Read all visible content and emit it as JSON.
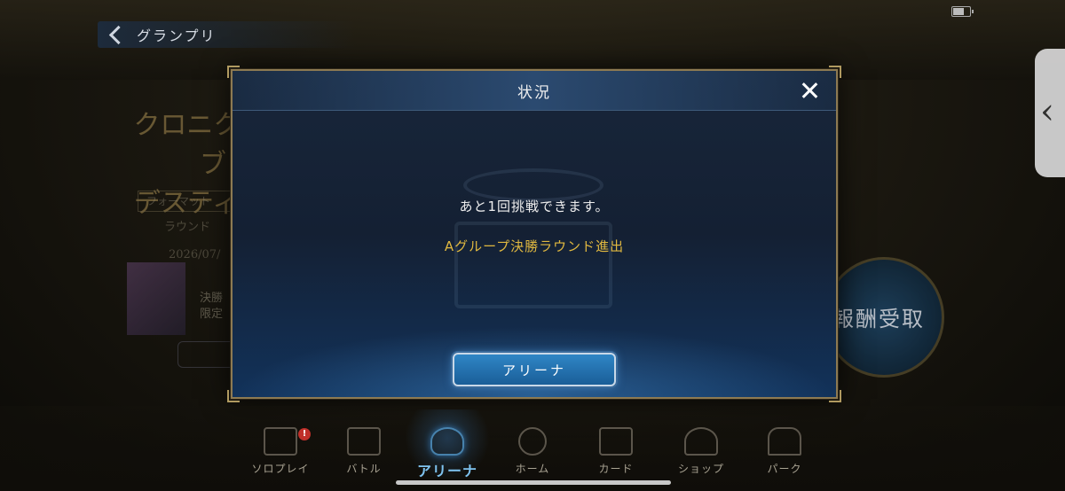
{
  "header": {
    "title": "グランプリ"
  },
  "background": {
    "event_title_line1": "クロニクル・オブ・",
    "event_title_line2": "デスティニー杯",
    "format_label": "フォーマット",
    "round_label": "ラウンド",
    "date_text": "2026/07/",
    "desc_line1": "決勝",
    "desc_line2": "限定",
    "claim_label": "報酬受取"
  },
  "modal": {
    "title": "状況",
    "message_attempts": "あと1回挑戦できます。",
    "message_status": "Aグループ決勝ラウンド進出",
    "button_label": "アリーナ"
  },
  "nav": {
    "items": [
      {
        "label": "ソロプレイ",
        "icon": "solo-play-icon"
      },
      {
        "label": "バトル",
        "icon": "crossed-swords-icon"
      },
      {
        "label": "アリーナ",
        "icon": "trophy-icon"
      },
      {
        "label": "ホーム",
        "icon": "compass-icon"
      },
      {
        "label": "カード",
        "icon": "cards-icon"
      },
      {
        "label": "ショップ",
        "icon": "shop-flame-icon"
      },
      {
        "label": "パーク",
        "icon": "park-arch-icon"
      }
    ],
    "active": "アリーナ",
    "badge": "!"
  },
  "colors": {
    "accent_gold": "#e0b840",
    "accent_blue": "#7fc3f0",
    "modal_border": "#8d7a52"
  }
}
